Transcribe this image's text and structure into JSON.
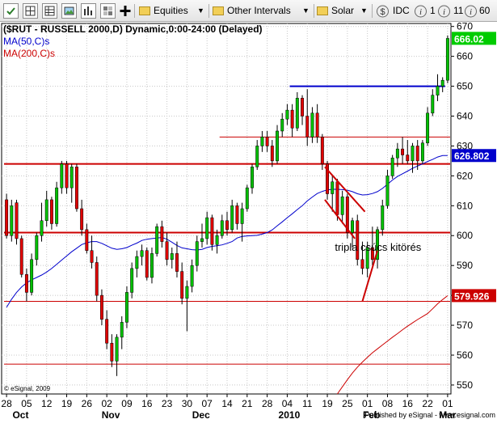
{
  "toolbar": {
    "equities_label": "Equities",
    "other_intervals_label": "Other Intervals",
    "solar_label": "Solar",
    "idc_label": "IDC",
    "one_label": "1",
    "eleven_label": "11",
    "sixty_label": "60",
    "icons": [
      "checkbox-icon",
      "grid-icon",
      "table-icon",
      "image-icon",
      "bars-icon",
      "tile-icon",
      "plus-icon",
      "folder-icon",
      "folder-icon",
      "folder-icon",
      "dollar-icon",
      "info-icon",
      "info-icon",
      "info-icon",
      "info-icon"
    ]
  },
  "chart_data": {
    "type": "candlestick",
    "title": "($RUT - RUSSELL 2000,D) Dynamic,0:00-24:00 (Delayed)",
    "ylim": [
      547,
      671
    ],
    "y_ticks": [
      550,
      560,
      570,
      580,
      590,
      600,
      610,
      620,
      630,
      640,
      650,
      660,
      670
    ],
    "x_day_labels": [
      "28",
      "05",
      "12",
      "19",
      "26",
      "02",
      "09",
      "16",
      "23",
      "30",
      "07",
      "14",
      "21",
      "28",
      "04",
      "11",
      "19",
      "25",
      "01",
      "08",
      "16",
      "22",
      "01"
    ],
    "x_month_labels": [
      "Oct",
      "Nov",
      "Dec",
      "2010",
      "Feb",
      "Mar"
    ],
    "grid": true,
    "candles": [
      {
        "o": 612,
        "h": 614,
        "l": 599,
        "c": 600,
        "color": "red"
      },
      {
        "o": 600,
        "h": 612,
        "l": 598,
        "c": 610,
        "color": "green"
      },
      {
        "o": 611,
        "h": 612,
        "l": 597,
        "c": 599,
        "color": "red"
      },
      {
        "o": 599,
        "h": 600,
        "l": 586,
        "c": 587,
        "color": "red"
      },
      {
        "o": 587,
        "h": 589,
        "l": 578,
        "c": 581,
        "color": "red"
      },
      {
        "o": 581,
        "h": 594,
        "l": 580,
        "c": 592,
        "color": "green"
      },
      {
        "o": 592,
        "h": 601,
        "l": 590,
        "c": 600,
        "color": "green"
      },
      {
        "o": 600,
        "h": 611,
        "l": 598,
        "c": 605,
        "color": "green"
      },
      {
        "o": 605,
        "h": 615,
        "l": 603,
        "c": 612,
        "color": "green"
      },
      {
        "o": 612,
        "h": 613,
        "l": 602,
        "c": 604,
        "color": "red"
      },
      {
        "o": 604,
        "h": 618,
        "l": 603,
        "c": 616,
        "color": "green"
      },
      {
        "o": 616,
        "h": 625,
        "l": 614,
        "c": 624,
        "color": "green"
      },
      {
        "o": 624,
        "h": 625,
        "l": 614,
        "c": 616,
        "color": "red"
      },
      {
        "o": 616,
        "h": 624,
        "l": 611,
        "c": 623,
        "color": "green"
      },
      {
        "o": 623,
        "h": 624,
        "l": 608,
        "c": 609,
        "color": "red"
      },
      {
        "o": 609,
        "h": 612,
        "l": 600,
        "c": 602,
        "color": "red"
      },
      {
        "o": 602,
        "h": 604,
        "l": 594,
        "c": 595,
        "color": "red"
      },
      {
        "o": 595,
        "h": 600,
        "l": 589,
        "c": 591,
        "color": "red"
      },
      {
        "o": 591,
        "h": 593,
        "l": 578,
        "c": 580,
        "color": "red"
      },
      {
        "o": 580,
        "h": 582,
        "l": 570,
        "c": 572,
        "color": "red"
      },
      {
        "o": 572,
        "h": 575,
        "l": 562,
        "c": 564,
        "color": "red"
      },
      {
        "o": 564,
        "h": 567,
        "l": 556,
        "c": 558,
        "color": "red"
      },
      {
        "o": 558,
        "h": 567,
        "l": 553,
        "c": 566,
        "color": "green"
      },
      {
        "o": 566,
        "h": 573,
        "l": 562,
        "c": 571,
        "color": "green"
      },
      {
        "o": 571,
        "h": 583,
        "l": 569,
        "c": 581,
        "color": "green"
      },
      {
        "o": 581,
        "h": 591,
        "l": 579,
        "c": 589,
        "color": "green"
      },
      {
        "o": 589,
        "h": 595,
        "l": 586,
        "c": 593,
        "color": "green"
      },
      {
        "o": 593,
        "h": 597,
        "l": 590,
        "c": 595,
        "color": "green"
      },
      {
        "o": 595,
        "h": 596,
        "l": 585,
        "c": 586,
        "color": "red"
      },
      {
        "o": 586,
        "h": 596,
        "l": 584,
        "c": 594,
        "color": "green"
      },
      {
        "o": 594,
        "h": 604,
        "l": 593,
        "c": 603,
        "color": "green"
      },
      {
        "o": 603,
        "h": 605,
        "l": 596,
        "c": 598,
        "color": "red"
      },
      {
        "o": 598,
        "h": 601,
        "l": 590,
        "c": 592,
        "color": "red"
      },
      {
        "o": 592,
        "h": 596,
        "l": 589,
        "c": 594,
        "color": "green"
      },
      {
        "o": 594,
        "h": 598,
        "l": 586,
        "c": 588,
        "color": "red"
      },
      {
        "o": 588,
        "h": 591,
        "l": 577,
        "c": 579,
        "color": "red"
      },
      {
        "o": 579,
        "h": 585,
        "l": 568,
        "c": 583,
        "color": "green"
      },
      {
        "o": 583,
        "h": 592,
        "l": 581,
        "c": 590,
        "color": "green"
      },
      {
        "o": 590,
        "h": 600,
        "l": 588,
        "c": 598,
        "color": "green"
      },
      {
        "o": 598,
        "h": 604,
        "l": 596,
        "c": 599,
        "color": "green"
      },
      {
        "o": 599,
        "h": 608,
        "l": 597,
        "c": 606,
        "color": "green"
      },
      {
        "o": 606,
        "h": 607,
        "l": 595,
        "c": 597,
        "color": "red"
      },
      {
        "o": 597,
        "h": 602,
        "l": 594,
        "c": 600,
        "color": "green"
      },
      {
        "o": 600,
        "h": 607,
        "l": 599,
        "c": 605,
        "color": "green"
      },
      {
        "o": 605,
        "h": 608,
        "l": 600,
        "c": 602,
        "color": "red"
      },
      {
        "o": 602,
        "h": 612,
        "l": 601,
        "c": 610,
        "color": "green"
      },
      {
        "o": 610,
        "h": 611,
        "l": 602,
        "c": 604,
        "color": "red"
      },
      {
        "o": 604,
        "h": 611,
        "l": 598,
        "c": 609,
        "color": "green"
      },
      {
        "o": 609,
        "h": 617,
        "l": 608,
        "c": 616,
        "color": "green"
      },
      {
        "o": 616,
        "h": 624,
        "l": 614,
        "c": 623,
        "color": "green"
      },
      {
        "o": 623,
        "h": 632,
        "l": 622,
        "c": 630,
        "color": "green"
      },
      {
        "o": 630,
        "h": 635,
        "l": 628,
        "c": 633,
        "color": "green"
      },
      {
        "o": 633,
        "h": 635,
        "l": 628,
        "c": 630,
        "color": "red"
      },
      {
        "o": 630,
        "h": 632,
        "l": 623,
        "c": 625,
        "color": "red"
      },
      {
        "o": 625,
        "h": 637,
        "l": 624,
        "c": 635,
        "color": "green"
      },
      {
        "o": 635,
        "h": 641,
        "l": 633,
        "c": 639,
        "color": "green"
      },
      {
        "o": 639,
        "h": 644,
        "l": 637,
        "c": 642,
        "color": "green"
      },
      {
        "o": 642,
        "h": 644,
        "l": 633,
        "c": 636,
        "color": "red"
      },
      {
        "o": 636,
        "h": 648,
        "l": 635,
        "c": 646,
        "color": "green"
      },
      {
        "o": 646,
        "h": 647,
        "l": 637,
        "c": 640,
        "color": "red"
      },
      {
        "o": 640,
        "h": 649,
        "l": 630,
        "c": 633,
        "color": "red"
      },
      {
        "o": 633,
        "h": 643,
        "l": 631,
        "c": 641,
        "color": "green"
      },
      {
        "o": 641,
        "h": 644,
        "l": 631,
        "c": 633,
        "color": "red"
      },
      {
        "o": 633,
        "h": 634,
        "l": 622,
        "c": 624,
        "color": "red"
      },
      {
        "o": 624,
        "h": 625,
        "l": 612,
        "c": 614,
        "color": "red"
      },
      {
        "o": 614,
        "h": 620,
        "l": 608,
        "c": 618,
        "color": "green"
      },
      {
        "o": 618,
        "h": 619,
        "l": 605,
        "c": 607,
        "color": "red"
      },
      {
        "o": 607,
        "h": 615,
        "l": 604,
        "c": 613,
        "color": "green"
      },
      {
        "o": 613,
        "h": 614,
        "l": 599,
        "c": 601,
        "color": "red"
      },
      {
        "o": 601,
        "h": 606,
        "l": 596,
        "c": 605,
        "color": "green"
      },
      {
        "o": 605,
        "h": 607,
        "l": 590,
        "c": 592,
        "color": "red"
      },
      {
        "o": 592,
        "h": 598,
        "l": 587,
        "c": 589,
        "color": "red"
      },
      {
        "o": 589,
        "h": 598,
        "l": 586,
        "c": 596,
        "color": "green"
      },
      {
        "o": 596,
        "h": 603,
        "l": 590,
        "c": 592,
        "color": "red"
      },
      {
        "o": 592,
        "h": 603,
        "l": 589,
        "c": 602,
        "color": "green"
      },
      {
        "o": 602,
        "h": 612,
        "l": 600,
        "c": 610,
        "color": "green"
      },
      {
        "o": 610,
        "h": 622,
        "l": 609,
        "c": 620,
        "color": "green"
      },
      {
        "o": 620,
        "h": 627,
        "l": 619,
        "c": 626,
        "color": "green"
      },
      {
        "o": 626,
        "h": 631,
        "l": 623,
        "c": 629,
        "color": "green"
      },
      {
        "o": 629,
        "h": 633,
        "l": 624,
        "c": 627,
        "color": "red"
      },
      {
        "o": 627,
        "h": 632,
        "l": 624,
        "c": 625,
        "color": "red"
      },
      {
        "o": 625,
        "h": 631,
        "l": 621,
        "c": 630,
        "color": "green"
      },
      {
        "o": 630,
        "h": 632,
        "l": 622,
        "c": 625,
        "color": "red"
      },
      {
        "o": 625,
        "h": 632,
        "l": 624,
        "c": 631,
        "color": "green"
      },
      {
        "o": 631,
        "h": 643,
        "l": 630,
        "c": 641,
        "color": "green"
      },
      {
        "o": 641,
        "h": 649,
        "l": 640,
        "c": 647,
        "color": "green"
      },
      {
        "o": 647,
        "h": 654,
        "l": 645,
        "c": 650,
        "color": "green"
      },
      {
        "o": 650,
        "h": 653,
        "l": 648,
        "c": 652,
        "color": "green"
      },
      {
        "o": 652,
        "h": 667,
        "l": 651,
        "c": 666,
        "color": "green"
      }
    ],
    "series": [
      {
        "name": "MA(50,C)s",
        "color": "#0000cc",
        "values": [
          576.0,
          578.7,
          581.0,
          582.8,
          584.2,
          585.2,
          586.0,
          586.8,
          587.8,
          589.0,
          590.4,
          591.8,
          593.2,
          594.6,
          595.8,
          597.0,
          597.6,
          598.0,
          598.0,
          597.4,
          596.6,
          595.8,
          595.4,
          595.6,
          596.0,
          596.8,
          597.5,
          598.4,
          598.8,
          599.0,
          599.2,
          599.4,
          598.8,
          597.8,
          596.7,
          595.9,
          595.6,
          595.3,
          595.2,
          595.4,
          596.0,
          596.4,
          596.6,
          596.9,
          597.4,
          598.0,
          599.2,
          599.7,
          599.9,
          600.0,
          600.1,
          600.5,
          601.0,
          601.9,
          603.3,
          604.6,
          606.0,
          607.3,
          608.7,
          610.0,
          611.6,
          612.9,
          614.1,
          614.8,
          615.3,
          615.5,
          615.5,
          615.4,
          615.2,
          614.7,
          614.0,
          613.6,
          613.7,
          614.1,
          614.7,
          615.8,
          617.2,
          618.6,
          619.8,
          620.7,
          621.6,
          622.5,
          623.3,
          624.0,
          624.8,
          625.5,
          626.3,
          626.8,
          626.8
        ]
      },
      {
        "name": "MA(200,C)s",
        "color": "#cc0000",
        "values": [
          null,
          null,
          null,
          null,
          null,
          null,
          null,
          null,
          null,
          null,
          null,
          null,
          null,
          null,
          null,
          null,
          null,
          null,
          null,
          null,
          null,
          null,
          null,
          null,
          null,
          null,
          null,
          null,
          null,
          null,
          null,
          null,
          null,
          null,
          null,
          null,
          null,
          null,
          null,
          null,
          null,
          null,
          null,
          null,
          null,
          null,
          null,
          null,
          null,
          null,
          null,
          null,
          null,
          null,
          null,
          null,
          null,
          null,
          null,
          null,
          null,
          null,
          null,
          null,
          null,
          null,
          547.0,
          549.4,
          551.8,
          554.0,
          556.0,
          557.7,
          559.3,
          560.8,
          562.1,
          563.4,
          564.7,
          566.0,
          567.2,
          568.5,
          569.7,
          570.8,
          571.9,
          572.9,
          573.9,
          575.5,
          577.2,
          578.6,
          579.9
        ]
      }
    ],
    "legend": {
      "placement": "top-left",
      "entries": [
        "MA(50,C)s",
        "MA(200,C)s"
      ]
    },
    "price_labels": [
      {
        "value": 666.02,
        "text": "666.02",
        "bg": "#00cc00"
      },
      {
        "value": 626.802,
        "text": "626.802",
        "bg": "#0000cc"
      },
      {
        "value": 579.926,
        "text": "579.926",
        "bg": "#cc0000"
      }
    ],
    "horizontal_lines": [
      {
        "y": 624,
        "x_start_index": 0,
        "x_end_index": 88,
        "color": "#cc0000",
        "weight": "thick"
      },
      {
        "y": 601,
        "x_start_index": 0,
        "x_end_index": 88,
        "color": "#cc0000",
        "weight": "thick"
      },
      {
        "y": 557,
        "x_start_index": 0,
        "x_end_index": 88,
        "color": "#cc0000",
        "weight": "thin"
      },
      {
        "y": 578,
        "x_start_index": 0,
        "x_end_index": 88,
        "color": "#cc0000",
        "weight": "thin"
      },
      {
        "y": 633,
        "x_start_index": 43,
        "x_end_index": 88,
        "color": "#cc0000",
        "weight": "thin"
      },
      {
        "y": 650,
        "x_start_index": 57,
        "x_end_index": 87,
        "color": "#0000cc",
        "weight": "medium"
      }
    ],
    "trend_lines": [
      {
        "x1_index": 63.5,
        "y1": 623,
        "x2_index": 71.5,
        "y2": 608,
        "color": "#cc0000"
      },
      {
        "x1_index": 63.5,
        "y1": 612,
        "x2_index": 69.5,
        "y2": 599,
        "color": "#cc0000"
      },
      {
        "x1_index": 71.0,
        "y1": 578,
        "x2_index": 74.0,
        "y2": 595,
        "color": "#cc0000"
      }
    ],
    "annotation": {
      "text": "tripla csúcs kitörés",
      "x_index": 65.5,
      "y": 596
    },
    "watermark": "© eSignal, 2009",
    "published_by": "Published by eSignal - www.esignal.com"
  }
}
